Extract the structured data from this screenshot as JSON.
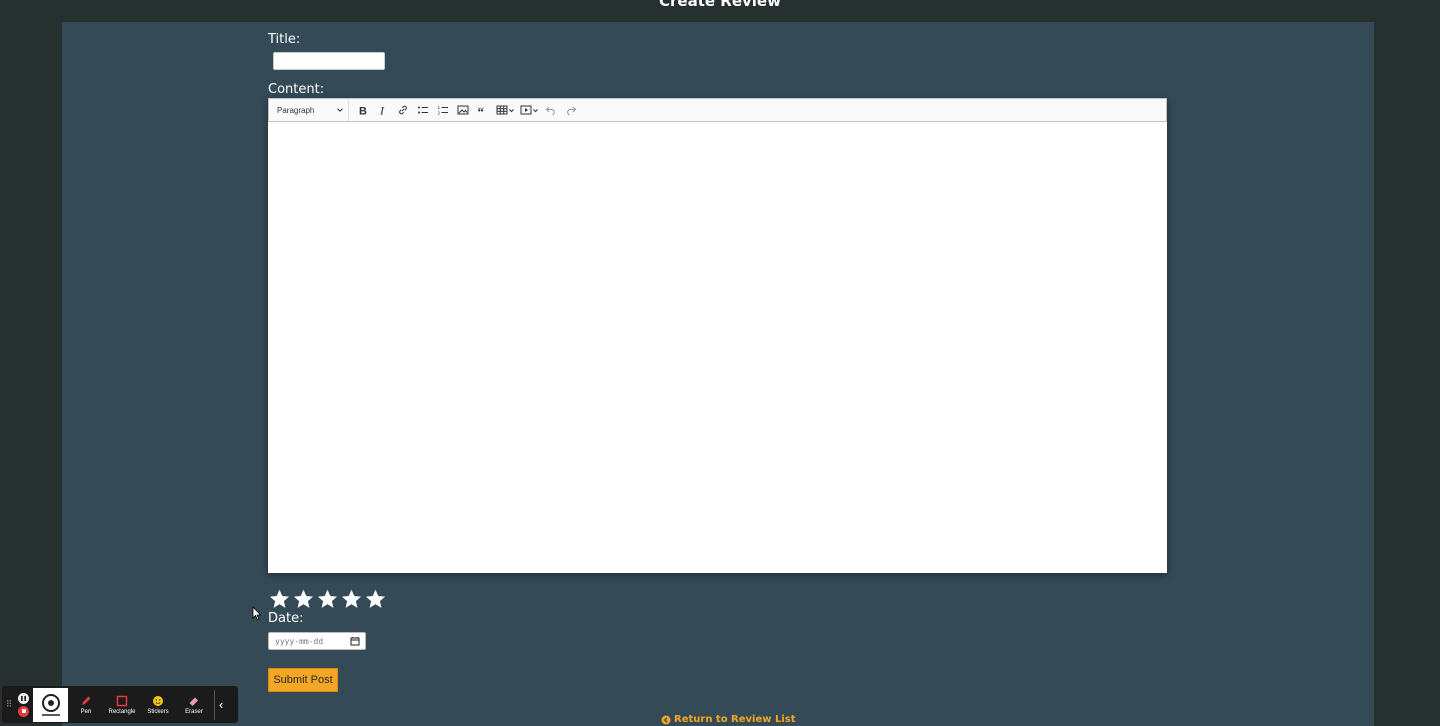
{
  "page": {
    "title": "Create Review"
  },
  "form": {
    "title_label": "Title:",
    "title_value": "",
    "content_label": "Content:",
    "date_label": "Date:",
    "date_placeholder": "yyyy-mm-dd",
    "submit_label": "Submit Post",
    "return_label": "Return to Review List"
  },
  "editor": {
    "heading_select": "Paragraph",
    "toolbar": [
      "bold-icon",
      "italic-icon",
      "link-icon",
      "bulleted-list-icon",
      "numbered-list-icon",
      "image-icon",
      "blockquote-icon",
      "table-icon",
      "media-icon",
      "undo-icon",
      "redo-icon"
    ]
  },
  "rating": {
    "max": 5,
    "value": 0
  },
  "annotation_toolbar": {
    "tools": [
      {
        "label": "Pen",
        "icon": "pen-icon"
      },
      {
        "label": "Rectangle",
        "icon": "rectangle-icon"
      },
      {
        "label": "Stickers",
        "icon": "sticker-icon"
      },
      {
        "label": "Eraser",
        "icon": "eraser-icon"
      }
    ]
  },
  "colors": {
    "background": "#26302f",
    "panel": "#344b57",
    "accent": "#f5a623",
    "tool_red": "#e23b3b"
  }
}
